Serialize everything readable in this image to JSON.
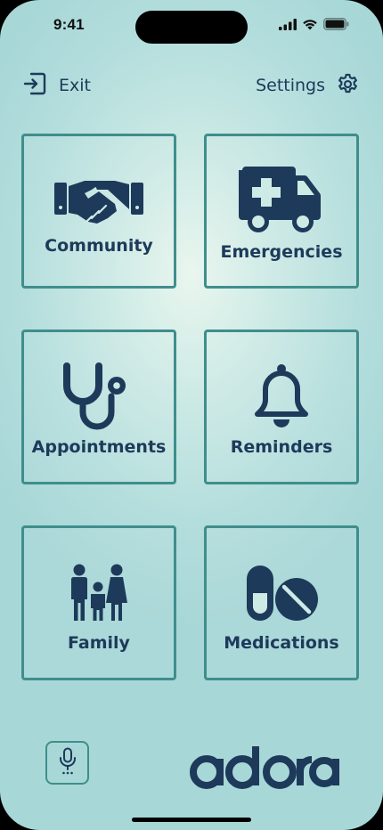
{
  "status_bar": {
    "time": "9:41",
    "icons": [
      "cellular-signal-icon",
      "wifi-icon",
      "battery-icon"
    ]
  },
  "nav": {
    "exit_label": "Exit",
    "settings_label": "Settings"
  },
  "tiles": [
    {
      "id": "community",
      "label": "Community",
      "icon": "handshake-icon"
    },
    {
      "id": "emergencies",
      "label": "Emergencies",
      "icon": "ambulance-icon"
    },
    {
      "id": "appointments",
      "label": "Appointments",
      "icon": "stethoscope-icon"
    },
    {
      "id": "reminders",
      "label": "Reminders",
      "icon": "bell-icon"
    },
    {
      "id": "family",
      "label": "Family",
      "icon": "family-icon"
    },
    {
      "id": "medications",
      "label": "Medications",
      "icon": "pills-icon"
    }
  ],
  "footer": {
    "mic_icon": "microphone-icon",
    "brand": "adora"
  },
  "colors": {
    "primary_navy": "#1d3a5a",
    "border_teal": "#3f8e8c",
    "background_teal": "#b4dedd",
    "background_center": "#e9f6ef"
  }
}
